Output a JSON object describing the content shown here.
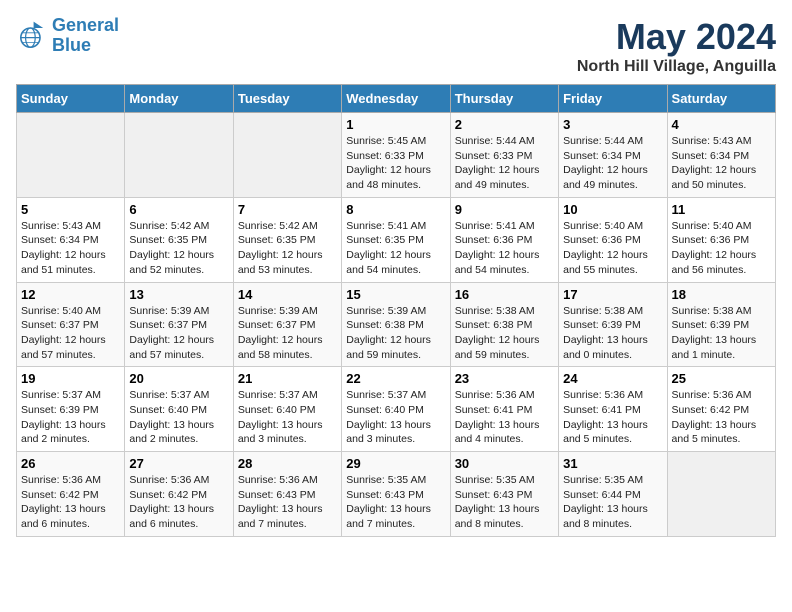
{
  "logo": {
    "line1": "General",
    "line2": "Blue"
  },
  "title": "May 2024",
  "subtitle": "North Hill Village, Anguilla",
  "days_header": [
    "Sunday",
    "Monday",
    "Tuesday",
    "Wednesday",
    "Thursday",
    "Friday",
    "Saturday"
  ],
  "weeks": [
    [
      {
        "num": "",
        "info": ""
      },
      {
        "num": "",
        "info": ""
      },
      {
        "num": "",
        "info": ""
      },
      {
        "num": "1",
        "info": "Sunrise: 5:45 AM\nSunset: 6:33 PM\nDaylight: 12 hours\nand 48 minutes."
      },
      {
        "num": "2",
        "info": "Sunrise: 5:44 AM\nSunset: 6:33 PM\nDaylight: 12 hours\nand 49 minutes."
      },
      {
        "num": "3",
        "info": "Sunrise: 5:44 AM\nSunset: 6:34 PM\nDaylight: 12 hours\nand 49 minutes."
      },
      {
        "num": "4",
        "info": "Sunrise: 5:43 AM\nSunset: 6:34 PM\nDaylight: 12 hours\nand 50 minutes."
      }
    ],
    [
      {
        "num": "5",
        "info": "Sunrise: 5:43 AM\nSunset: 6:34 PM\nDaylight: 12 hours\nand 51 minutes."
      },
      {
        "num": "6",
        "info": "Sunrise: 5:42 AM\nSunset: 6:35 PM\nDaylight: 12 hours\nand 52 minutes."
      },
      {
        "num": "7",
        "info": "Sunrise: 5:42 AM\nSunset: 6:35 PM\nDaylight: 12 hours\nand 53 minutes."
      },
      {
        "num": "8",
        "info": "Sunrise: 5:41 AM\nSunset: 6:35 PM\nDaylight: 12 hours\nand 54 minutes."
      },
      {
        "num": "9",
        "info": "Sunrise: 5:41 AM\nSunset: 6:36 PM\nDaylight: 12 hours\nand 54 minutes."
      },
      {
        "num": "10",
        "info": "Sunrise: 5:40 AM\nSunset: 6:36 PM\nDaylight: 12 hours\nand 55 minutes."
      },
      {
        "num": "11",
        "info": "Sunrise: 5:40 AM\nSunset: 6:36 PM\nDaylight: 12 hours\nand 56 minutes."
      }
    ],
    [
      {
        "num": "12",
        "info": "Sunrise: 5:40 AM\nSunset: 6:37 PM\nDaylight: 12 hours\nand 57 minutes."
      },
      {
        "num": "13",
        "info": "Sunrise: 5:39 AM\nSunset: 6:37 PM\nDaylight: 12 hours\nand 57 minutes."
      },
      {
        "num": "14",
        "info": "Sunrise: 5:39 AM\nSunset: 6:37 PM\nDaylight: 12 hours\nand 58 minutes."
      },
      {
        "num": "15",
        "info": "Sunrise: 5:39 AM\nSunset: 6:38 PM\nDaylight: 12 hours\nand 59 minutes."
      },
      {
        "num": "16",
        "info": "Sunrise: 5:38 AM\nSunset: 6:38 PM\nDaylight: 12 hours\nand 59 minutes."
      },
      {
        "num": "17",
        "info": "Sunrise: 5:38 AM\nSunset: 6:39 PM\nDaylight: 13 hours\nand 0 minutes."
      },
      {
        "num": "18",
        "info": "Sunrise: 5:38 AM\nSunset: 6:39 PM\nDaylight: 13 hours\nand 1 minute."
      }
    ],
    [
      {
        "num": "19",
        "info": "Sunrise: 5:37 AM\nSunset: 6:39 PM\nDaylight: 13 hours\nand 2 minutes."
      },
      {
        "num": "20",
        "info": "Sunrise: 5:37 AM\nSunset: 6:40 PM\nDaylight: 13 hours\nand 2 minutes."
      },
      {
        "num": "21",
        "info": "Sunrise: 5:37 AM\nSunset: 6:40 PM\nDaylight: 13 hours\nand 3 minutes."
      },
      {
        "num": "22",
        "info": "Sunrise: 5:37 AM\nSunset: 6:40 PM\nDaylight: 13 hours\nand 3 minutes."
      },
      {
        "num": "23",
        "info": "Sunrise: 5:36 AM\nSunset: 6:41 PM\nDaylight: 13 hours\nand 4 minutes."
      },
      {
        "num": "24",
        "info": "Sunrise: 5:36 AM\nSunset: 6:41 PM\nDaylight: 13 hours\nand 5 minutes."
      },
      {
        "num": "25",
        "info": "Sunrise: 5:36 AM\nSunset: 6:42 PM\nDaylight: 13 hours\nand 5 minutes."
      }
    ],
    [
      {
        "num": "26",
        "info": "Sunrise: 5:36 AM\nSunset: 6:42 PM\nDaylight: 13 hours\nand 6 minutes."
      },
      {
        "num": "27",
        "info": "Sunrise: 5:36 AM\nSunset: 6:42 PM\nDaylight: 13 hours\nand 6 minutes."
      },
      {
        "num": "28",
        "info": "Sunrise: 5:36 AM\nSunset: 6:43 PM\nDaylight: 13 hours\nand 7 minutes."
      },
      {
        "num": "29",
        "info": "Sunrise: 5:35 AM\nSunset: 6:43 PM\nDaylight: 13 hours\nand 7 minutes."
      },
      {
        "num": "30",
        "info": "Sunrise: 5:35 AM\nSunset: 6:43 PM\nDaylight: 13 hours\nand 8 minutes."
      },
      {
        "num": "31",
        "info": "Sunrise: 5:35 AM\nSunset: 6:44 PM\nDaylight: 13 hours\nand 8 minutes."
      },
      {
        "num": "",
        "info": ""
      }
    ]
  ]
}
